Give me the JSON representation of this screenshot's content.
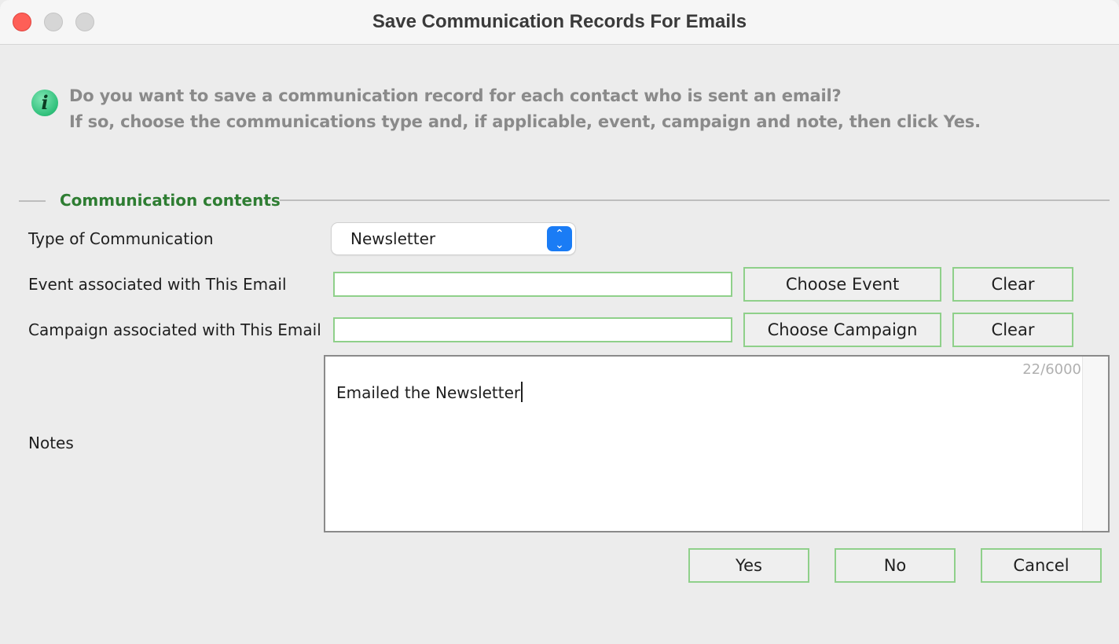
{
  "window": {
    "title": "Save Communication Records For Emails"
  },
  "info": {
    "line1": "Do you want to save a communication record for each contact who is sent an email?",
    "line2": "If so, choose the communications type and, if applicable, event, campaign and note, then click Yes."
  },
  "section": {
    "title": "Communication contents"
  },
  "form": {
    "type_label": "Type of Communication",
    "type_value": "Newsletter",
    "event_label": "Event associated with This Email",
    "event_value": "",
    "choose_event_label": "Choose Event",
    "clear_event_label": "Clear",
    "campaign_label": "Campaign associated with This Email",
    "campaign_value": "",
    "choose_campaign_label": "Choose Campaign",
    "clear_campaign_label": "Clear",
    "notes_label": "Notes",
    "notes_value": "Emailed the Newsletter",
    "notes_count": "22/6000"
  },
  "actions": {
    "yes_label": "Yes",
    "no_label": "No",
    "cancel_label": "Cancel"
  },
  "colors": {
    "accent_green": "#2e7d32",
    "field_border": "#8fd08a",
    "select_arrow": "#1a7cf5",
    "close_button": "#fe5f57"
  },
  "icons": {
    "info": "info-icon",
    "select_arrows": "chevron-up-down-icon"
  }
}
